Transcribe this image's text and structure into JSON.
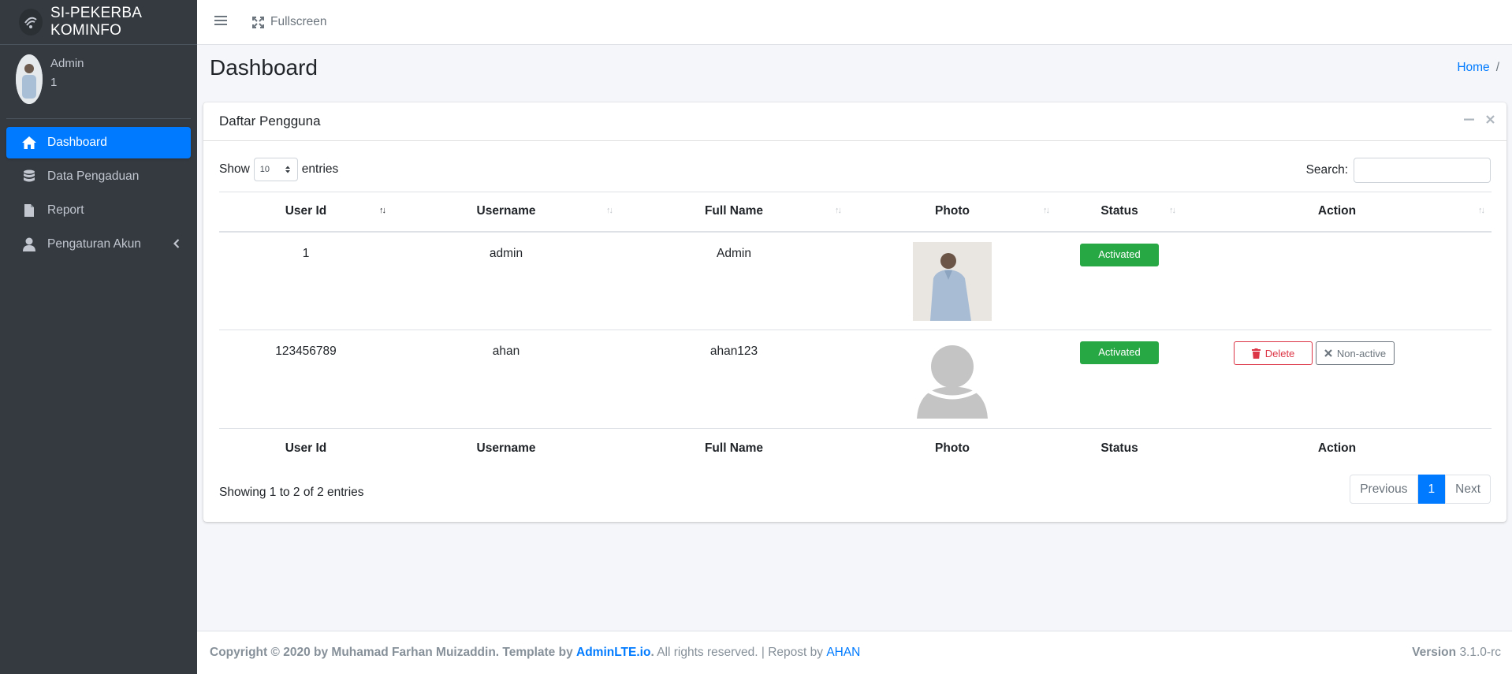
{
  "brand": {
    "title": "SI-PEKERBA KOMINFO",
    "logo_icon": "kominfo-logo-icon"
  },
  "user": {
    "name": "Admin",
    "id": "1"
  },
  "sidebar": {
    "items": [
      {
        "label": "Dashboard",
        "icon": "home-icon",
        "active": true
      },
      {
        "label": "Data Pengaduan",
        "icon": "database-icon"
      },
      {
        "label": "Report",
        "icon": "file-icon"
      },
      {
        "label": "Pengaturan Akun",
        "icon": "user-icon"
      }
    ]
  },
  "topbar": {
    "fullscreen_label": "Fullscreen"
  },
  "header": {
    "title": "Dashboard",
    "breadcrumb_home": "Home",
    "breadcrumb_sep": "/"
  },
  "card": {
    "title": "Daftar Pengguna",
    "show_label": "Show",
    "entries_value": "10",
    "entries_label": "entries",
    "search_label": "Search:",
    "columns": [
      "User Id",
      "Username",
      "Full Name",
      "Photo",
      "Status",
      "Action"
    ],
    "rows": [
      {
        "user_id": "1",
        "username": "admin",
        "full_name": "Admin",
        "status": "Activated"
      },
      {
        "user_id": "123456789",
        "username": "ahan",
        "full_name": "ahan123",
        "status": "Activated",
        "delete_label": "Delete",
        "nonactive_label": "Non-active"
      }
    ],
    "info": "Showing 1 to 2 of 2 entries",
    "pager": {
      "previous": "Previous",
      "current": "1",
      "next": "Next"
    }
  },
  "footer": {
    "copyright": "Copyright © 2020 by Muhamad Farhan Muizaddin. Template by",
    "template_link": "AdminLTE.io",
    "dot": ".",
    "rights": " All rights reserved. | Repost by ",
    "repost_link": "AHAN",
    "version_label": "Version",
    "version_value": "3.1.0-rc"
  },
  "colors": {
    "primary": "#007bff",
    "success": "#28a745",
    "danger": "#dc3545",
    "sidebar": "#343a40"
  }
}
